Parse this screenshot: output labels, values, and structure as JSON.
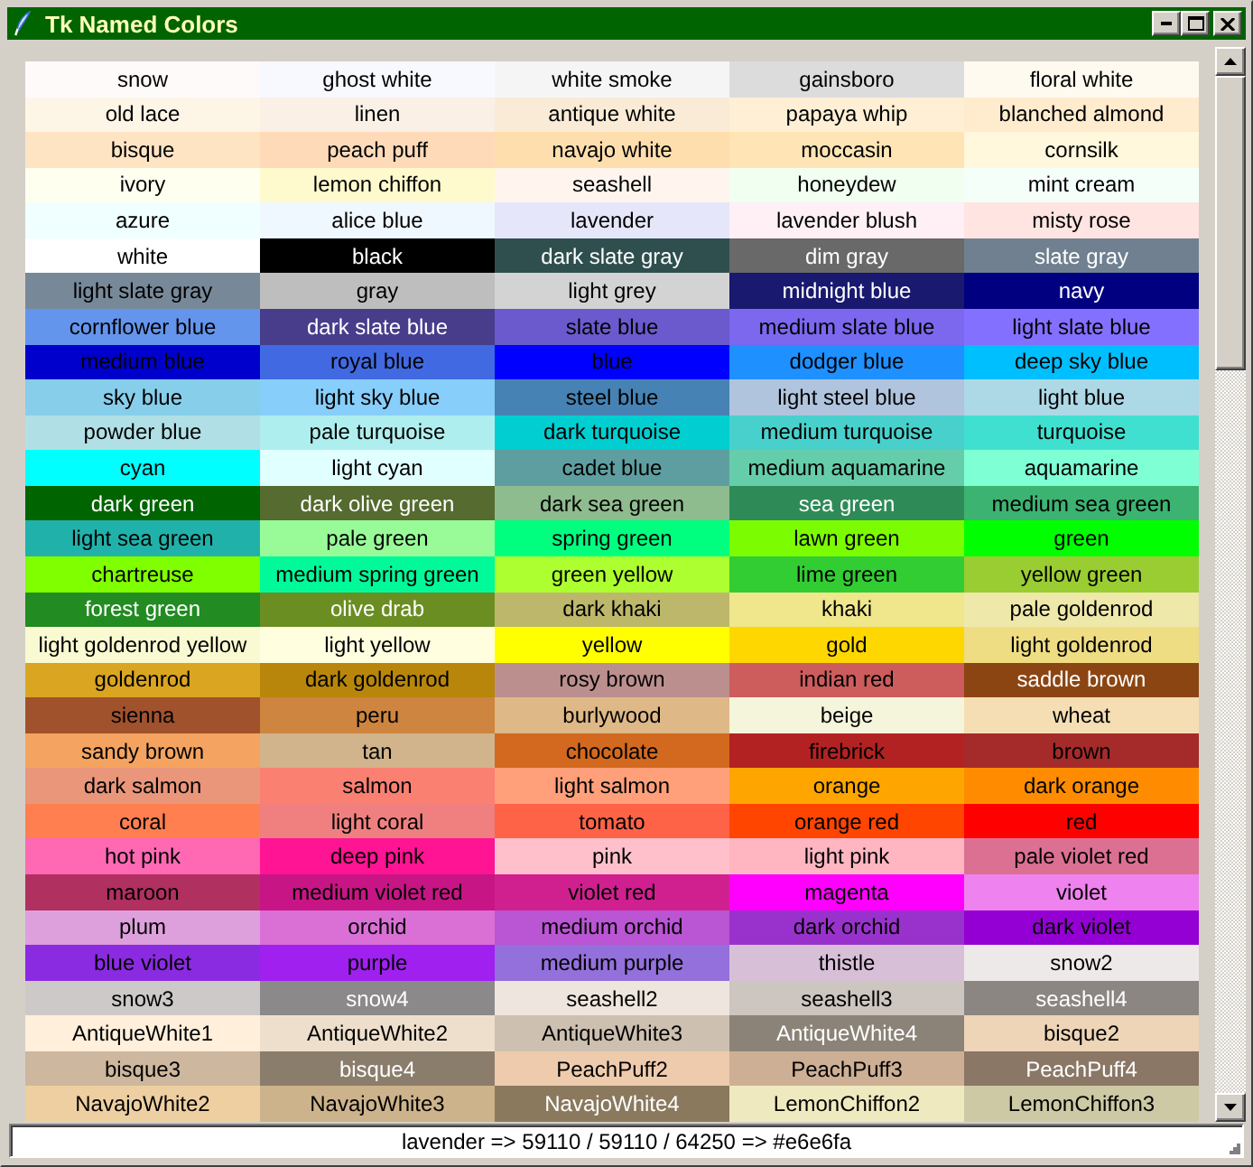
{
  "window": {
    "title": "Tk Named Colors"
  },
  "colors": [
    {
      "name": "snow",
      "color": "#fffafa"
    },
    {
      "name": "ghost white",
      "color": "#f8f8ff"
    },
    {
      "name": "white smoke",
      "color": "#f5f5f5"
    },
    {
      "name": "gainsboro",
      "color": "#dcdcdc"
    },
    {
      "name": "floral white",
      "color": "#fffaf0"
    },
    {
      "name": "old lace",
      "color": "#fdf5e6"
    },
    {
      "name": "linen",
      "color": "#faf0e6"
    },
    {
      "name": "antique white",
      "color": "#faebd7"
    },
    {
      "name": "papaya whip",
      "color": "#ffefd5"
    },
    {
      "name": "blanched almond",
      "color": "#ffebcd"
    },
    {
      "name": "bisque",
      "color": "#ffe4c4"
    },
    {
      "name": "peach puff",
      "color": "#ffdab9"
    },
    {
      "name": "navajo white",
      "color": "#ffdead"
    },
    {
      "name": "moccasin",
      "color": "#ffe4b5"
    },
    {
      "name": "cornsilk",
      "color": "#fff8dc"
    },
    {
      "name": "ivory",
      "color": "#fffff0"
    },
    {
      "name": "lemon chiffon",
      "color": "#fffacd"
    },
    {
      "name": "seashell",
      "color": "#fff5ee"
    },
    {
      "name": "honeydew",
      "color": "#f0fff0"
    },
    {
      "name": "mint cream",
      "color": "#f5fffa"
    },
    {
      "name": "azure",
      "color": "#f0ffff"
    },
    {
      "name": "alice blue",
      "color": "#f0f8ff"
    },
    {
      "name": "lavender",
      "color": "#e6e6fa"
    },
    {
      "name": "lavender blush",
      "color": "#fff0f5"
    },
    {
      "name": "misty rose",
      "color": "#ffe4e1"
    },
    {
      "name": "white",
      "color": "#ffffff"
    },
    {
      "name": "black",
      "color": "#000000"
    },
    {
      "name": "dark slate gray",
      "color": "#2f4f4f"
    },
    {
      "name": "dim gray",
      "color": "#696969"
    },
    {
      "name": "slate gray",
      "color": "#708090"
    },
    {
      "name": "light slate gray",
      "color": "#778899"
    },
    {
      "name": "gray",
      "color": "#bebebe"
    },
    {
      "name": "light grey",
      "color": "#d3d3d3"
    },
    {
      "name": "midnight blue",
      "color": "#191970"
    },
    {
      "name": "navy",
      "color": "#000080"
    },
    {
      "name": "cornflower blue",
      "color": "#6495ed"
    },
    {
      "name": "dark slate blue",
      "color": "#483d8b"
    },
    {
      "name": "slate blue",
      "color": "#6a5acd"
    },
    {
      "name": "medium slate blue",
      "color": "#7b68ee"
    },
    {
      "name": "light slate blue",
      "color": "#8470ff"
    },
    {
      "name": "medium blue",
      "color": "#0000cd"
    },
    {
      "name": "royal blue",
      "color": "#4169e1"
    },
    {
      "name": "blue",
      "color": "#0000ff"
    },
    {
      "name": "dodger blue",
      "color": "#1e90ff"
    },
    {
      "name": "deep sky blue",
      "color": "#00bfff"
    },
    {
      "name": "sky blue",
      "color": "#87ceeb"
    },
    {
      "name": "light sky blue",
      "color": "#87cefa"
    },
    {
      "name": "steel blue",
      "color": "#4682b4"
    },
    {
      "name": "light steel blue",
      "color": "#b0c4de"
    },
    {
      "name": "light blue",
      "color": "#add8e6"
    },
    {
      "name": "powder blue",
      "color": "#b0e0e6"
    },
    {
      "name": "pale turquoise",
      "color": "#afeeee"
    },
    {
      "name": "dark turquoise",
      "color": "#00ced1"
    },
    {
      "name": "medium turquoise",
      "color": "#48d1cc"
    },
    {
      "name": "turquoise",
      "color": "#40e0d0"
    },
    {
      "name": "cyan",
      "color": "#00ffff"
    },
    {
      "name": "light cyan",
      "color": "#e0ffff"
    },
    {
      "name": "cadet blue",
      "color": "#5f9ea0"
    },
    {
      "name": "medium aquamarine",
      "color": "#66cdaa"
    },
    {
      "name": "aquamarine",
      "color": "#7fffd4"
    },
    {
      "name": "dark green",
      "color": "#006400"
    },
    {
      "name": "dark olive green",
      "color": "#556b2f"
    },
    {
      "name": "dark sea green",
      "color": "#8fbc8f"
    },
    {
      "name": "sea green",
      "color": "#2e8b57"
    },
    {
      "name": "medium sea green",
      "color": "#3cb371"
    },
    {
      "name": "light sea green",
      "color": "#20b2aa"
    },
    {
      "name": "pale green",
      "color": "#98fb98"
    },
    {
      "name": "spring green",
      "color": "#00ff7f"
    },
    {
      "name": "lawn green",
      "color": "#7cfc00"
    },
    {
      "name": "green",
      "color": "#00ff00"
    },
    {
      "name": "chartreuse",
      "color": "#7fff00"
    },
    {
      "name": "medium spring green",
      "color": "#00fa9a"
    },
    {
      "name": "green yellow",
      "color": "#adff2f"
    },
    {
      "name": "lime green",
      "color": "#32cd32"
    },
    {
      "name": "yellow green",
      "color": "#9acd32"
    },
    {
      "name": "forest green",
      "color": "#228b22"
    },
    {
      "name": "olive drab",
      "color": "#6b8e23"
    },
    {
      "name": "dark khaki",
      "color": "#bdb76b"
    },
    {
      "name": "khaki",
      "color": "#f0e68c"
    },
    {
      "name": "pale goldenrod",
      "color": "#eee8aa"
    },
    {
      "name": "light goldenrod yellow",
      "color": "#fafad2"
    },
    {
      "name": "light yellow",
      "color": "#ffffe0"
    },
    {
      "name": "yellow",
      "color": "#ffff00"
    },
    {
      "name": "gold",
      "color": "#ffd700"
    },
    {
      "name": "light goldenrod",
      "color": "#eedd82"
    },
    {
      "name": "goldenrod",
      "color": "#daa520"
    },
    {
      "name": "dark goldenrod",
      "color": "#b8860b"
    },
    {
      "name": "rosy brown",
      "color": "#bc8f8f"
    },
    {
      "name": "indian red",
      "color": "#cd5c5c"
    },
    {
      "name": "saddle brown",
      "color": "#8b4513"
    },
    {
      "name": "sienna",
      "color": "#a0522d"
    },
    {
      "name": "peru",
      "color": "#cd853f"
    },
    {
      "name": "burlywood",
      "color": "#deb887"
    },
    {
      "name": "beige",
      "color": "#f5f5dc"
    },
    {
      "name": "wheat",
      "color": "#f5deb3"
    },
    {
      "name": "sandy brown",
      "color": "#f4a460"
    },
    {
      "name": "tan",
      "color": "#d2b48c"
    },
    {
      "name": "chocolate",
      "color": "#d2691e"
    },
    {
      "name": "firebrick",
      "color": "#b22222"
    },
    {
      "name": "brown",
      "color": "#a52a2a"
    },
    {
      "name": "dark salmon",
      "color": "#e9967a"
    },
    {
      "name": "salmon",
      "color": "#fa8072"
    },
    {
      "name": "light salmon",
      "color": "#ffa07a"
    },
    {
      "name": "orange",
      "color": "#ffa500"
    },
    {
      "name": "dark orange",
      "color": "#ff8c00"
    },
    {
      "name": "coral",
      "color": "#ff7f50"
    },
    {
      "name": "light coral",
      "color": "#f08080"
    },
    {
      "name": "tomato",
      "color": "#ff6347"
    },
    {
      "name": "orange red",
      "color": "#ff4500"
    },
    {
      "name": "red",
      "color": "#ff0000"
    },
    {
      "name": "hot pink",
      "color": "#ff69b4"
    },
    {
      "name": "deep pink",
      "color": "#ff1493"
    },
    {
      "name": "pink",
      "color": "#ffc0cb"
    },
    {
      "name": "light pink",
      "color": "#ffb6c1"
    },
    {
      "name": "pale violet red",
      "color": "#db7093"
    },
    {
      "name": "maroon",
      "color": "#b03060"
    },
    {
      "name": "medium violet red",
      "color": "#c71585"
    },
    {
      "name": "violet red",
      "color": "#d02090"
    },
    {
      "name": "magenta",
      "color": "#ff00ff"
    },
    {
      "name": "violet",
      "color": "#ee82ee"
    },
    {
      "name": "plum",
      "color": "#dda0dd"
    },
    {
      "name": "orchid",
      "color": "#da70d6"
    },
    {
      "name": "medium orchid",
      "color": "#ba55d3"
    },
    {
      "name": "dark orchid",
      "color": "#9932cc"
    },
    {
      "name": "dark violet",
      "color": "#9400d3"
    },
    {
      "name": "blue violet",
      "color": "#8a2be2"
    },
    {
      "name": "purple",
      "color": "#a020f0"
    },
    {
      "name": "medium purple",
      "color": "#9370db"
    },
    {
      "name": "thistle",
      "color": "#d8bfd8"
    },
    {
      "name": "snow2",
      "color": "#eee9e9"
    },
    {
      "name": "snow3",
      "color": "#cdc9c9"
    },
    {
      "name": "snow4",
      "color": "#8b8989"
    },
    {
      "name": "seashell2",
      "color": "#eee5de"
    },
    {
      "name": "seashell3",
      "color": "#cdc5bf"
    },
    {
      "name": "seashell4",
      "color": "#8b8682"
    },
    {
      "name": "AntiqueWhite1",
      "color": "#ffefdb"
    },
    {
      "name": "AntiqueWhite2",
      "color": "#eedfcc"
    },
    {
      "name": "AntiqueWhite3",
      "color": "#cdc0b0"
    },
    {
      "name": "AntiqueWhite4",
      "color": "#8b8378"
    },
    {
      "name": "bisque2",
      "color": "#eed5b7"
    },
    {
      "name": "bisque3",
      "color": "#cdb79e"
    },
    {
      "name": "bisque4",
      "color": "#8b7d6b"
    },
    {
      "name": "PeachPuff2",
      "color": "#eecbad"
    },
    {
      "name": "PeachPuff3",
      "color": "#cdaf95"
    },
    {
      "name": "PeachPuff4",
      "color": "#8b7765"
    },
    {
      "name": "NavajoWhite2",
      "color": "#eecfa1"
    },
    {
      "name": "NavajoWhite3",
      "color": "#cdb38b"
    },
    {
      "name": "NavajoWhite4",
      "color": "#8b795e"
    },
    {
      "name": "LemonChiffon2",
      "color": "#eee9bf"
    },
    {
      "name": "LemonChiffon3",
      "color": "#cdc9a5"
    }
  ],
  "status_bar": {
    "text": "lavender => 59110 / 59110 / 64250 => #e6e6fa"
  }
}
